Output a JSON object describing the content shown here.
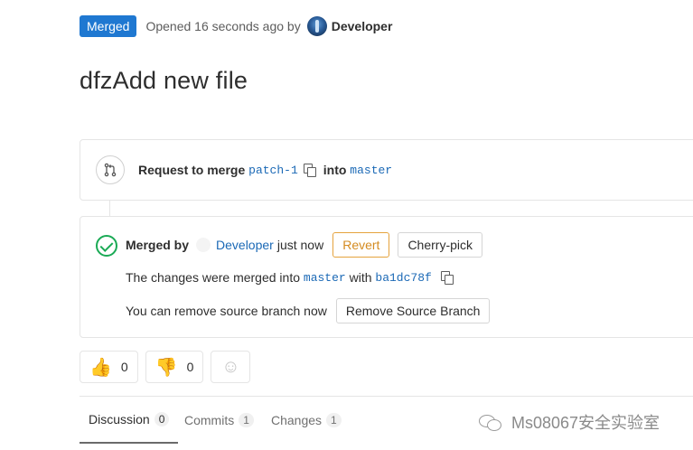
{
  "header": {
    "status_badge": "Merged",
    "opened_text": "Opened 16 seconds ago by",
    "author": "Developer"
  },
  "title": "dfzAdd new file",
  "request": {
    "label": "Request to merge",
    "source_branch": "patch-1",
    "into_label": "into",
    "target_branch": "master"
  },
  "merged": {
    "label": "Merged by",
    "user": "Developer",
    "when": "just now",
    "revert_label": "Revert",
    "cherry_pick_label": "Cherry-pick",
    "changes_prefix": "The changes were merged into",
    "target_branch": "master",
    "with_label": "with",
    "commit_sha": "ba1dc78f",
    "remove_text": "You can remove source branch now",
    "remove_button_label": "Remove Source Branch"
  },
  "reactions": {
    "thumbs_up": {
      "icon": "thumbs-up-icon",
      "glyph": "👍",
      "count": "0"
    },
    "thumbs_down": {
      "icon": "thumbs-down-icon",
      "glyph": "👎",
      "count": "0"
    },
    "add": {
      "icon": "smiley-icon",
      "glyph": "☺"
    }
  },
  "tabs": [
    {
      "label": "Discussion",
      "count": "0",
      "active": true
    },
    {
      "label": "Commits",
      "count": "1",
      "active": false
    },
    {
      "label": "Changes",
      "count": "1",
      "active": false
    }
  ],
  "watermark": "Ms08067安全实验室",
  "colors": {
    "badge": "#1f78d1",
    "link": "#1b69b6",
    "success": "#1aaa55",
    "revert": "#d48b21"
  }
}
